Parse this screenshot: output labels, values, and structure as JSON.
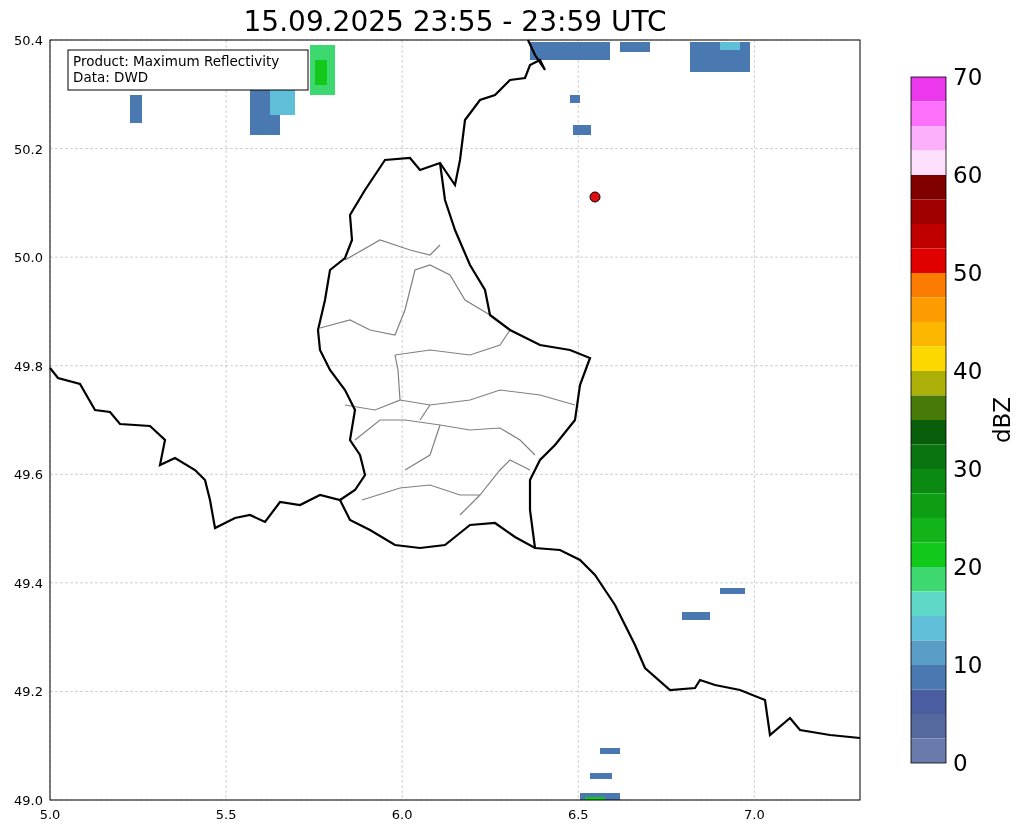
{
  "title": "15.09.2025 23:55 - 23:59 UTC",
  "legend": {
    "lines": [
      "Product: Maximum Reflectivity",
      "Data: DWD"
    ]
  },
  "map": {
    "xticks": [
      "5.0",
      "5.5",
      "6.0",
      "6.5",
      "7.0"
    ],
    "yticks": [
      "50.4",
      "50.2",
      "50.0",
      "49.8",
      "49.6",
      "49.4",
      "49.2",
      "49.0"
    ]
  },
  "colorbar": {
    "label": "dBZ",
    "ticks": [
      "70",
      "60",
      "50",
      "40",
      "30",
      "20",
      "10",
      "0"
    ],
    "segments": [
      {
        "color": "#ec38ec"
      },
      {
        "color": "#fc70fc"
      },
      {
        "color": "#fcb0fc"
      },
      {
        "color": "#fee0fe"
      },
      {
        "color": "#800000"
      },
      {
        "color": "#a00000"
      },
      {
        "color": "#c00000"
      },
      {
        "color": "#e00000"
      },
      {
        "color": "#fc7c00"
      },
      {
        "color": "#fc9c00"
      },
      {
        "color": "#fcb800"
      },
      {
        "color": "#fcd800"
      },
      {
        "color": "#aeb00a"
      },
      {
        "color": "#487a0a"
      },
      {
        "color": "#095e0c"
      },
      {
        "color": "#0a7410"
      },
      {
        "color": "#0b8a12"
      },
      {
        "color": "#0e9e14"
      },
      {
        "color": "#12b41a"
      },
      {
        "color": "#12c81a"
      },
      {
        "color": "#3ed870"
      },
      {
        "color": "#5fd8c8"
      },
      {
        "color": "#5fbfd8"
      },
      {
        "color": "#5a9ec8"
      },
      {
        "color": "#4a78b0"
      },
      {
        "color": "#4a5da0"
      },
      {
        "color": "#56699f"
      },
      {
        "color": "#6a7aab"
      }
    ]
  }
}
